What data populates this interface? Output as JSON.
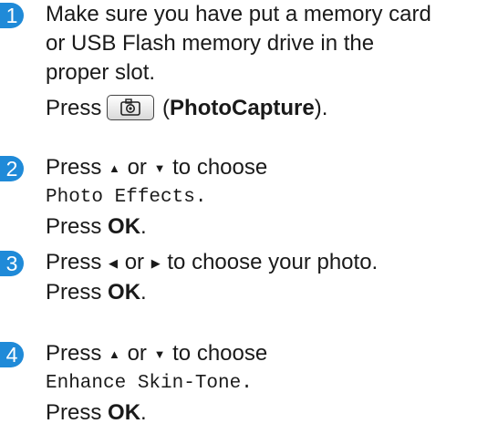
{
  "colors": {
    "step_badge": "#1f8ad8",
    "text": "#1a1a1a"
  },
  "steps": [
    {
      "number": "1",
      "line1": "Make sure you have put a memory card",
      "line2": "or USB Flash memory drive in the",
      "line3": "proper slot.",
      "press": "Press",
      "button_icon": "camera-icon",
      "open_paren": "(",
      "button_name": "PhotoCapture",
      "close_paren": ")."
    },
    {
      "number": "2",
      "press": "Press",
      "up_arrow": "▲",
      "or": "or",
      "down_arrow": "▼",
      "to_choose": "to choose",
      "option": "Photo Effects.",
      "press_ok": "Press",
      "ok": "OK",
      "period": "."
    },
    {
      "number": "3",
      "press": "Press",
      "left_arrow": "◀",
      "or": "or",
      "right_arrow": "▶",
      "to_choose": "to choose your photo.",
      "press_ok": "Press",
      "ok": "OK",
      "period": "."
    },
    {
      "number": "4",
      "press": "Press",
      "up_arrow": "▲",
      "or": "or",
      "down_arrow": "▼",
      "to_choose": "to choose",
      "option": "Enhance Skin-Tone.",
      "press_ok": "Press",
      "ok": "OK",
      "period": "."
    }
  ]
}
